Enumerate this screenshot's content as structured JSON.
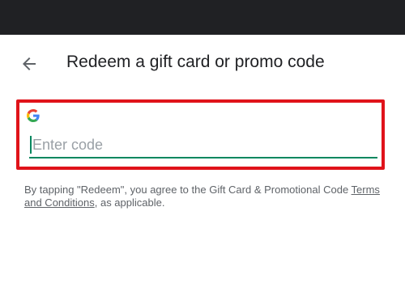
{
  "app_bar": {
    "back_icon": "arrow-back-icon",
    "title": "Redeem a gift card or promo code"
  },
  "code_field": {
    "brand_icon": "google-g-icon",
    "placeholder": "Enter code",
    "value": ""
  },
  "disclaimer": {
    "prefix": "By tapping \"Redeem\", you agree to the Gift Card & Promotional Code ",
    "link_text": "Terms and Conditions",
    "suffix": ", as applicable."
  },
  "colors": {
    "status_bar": "#202124",
    "highlight_border": "#e0131a",
    "accent": "#01875f",
    "title_text": "#202124",
    "secondary_text": "#5f6368"
  }
}
